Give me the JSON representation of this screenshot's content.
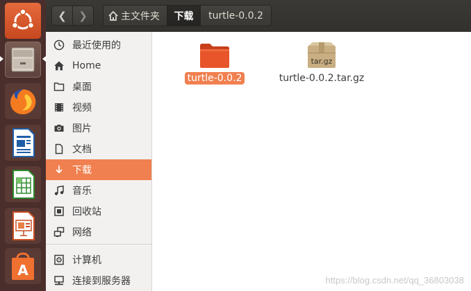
{
  "launcher": {
    "items": [
      {
        "name": "ubuntu-dash",
        "color": "#e35c2f"
      },
      {
        "name": "files",
        "color": "#c9b8a8"
      },
      {
        "name": "firefox",
        "color": "#f47b20"
      },
      {
        "name": "libreoffice-writer",
        "color": "#2a6eb5"
      },
      {
        "name": "libreoffice-calc",
        "color": "#3c9d3c"
      },
      {
        "name": "libreoffice-impress",
        "color": "#d4592f"
      },
      {
        "name": "software-center",
        "color": "#f07030"
      }
    ]
  },
  "header": {
    "back_glyph": "❮",
    "forward_glyph": "❯",
    "breadcrumbs": [
      {
        "label": "主文件夹",
        "icon": "home-icon"
      },
      {
        "label": "下载",
        "active": true
      },
      {
        "label": "turtle-0.0.2"
      }
    ]
  },
  "sidebar": {
    "items": [
      {
        "label": "最近使用的",
        "icon": "clock-icon"
      },
      {
        "label": "Home",
        "icon": "home-icon"
      },
      {
        "label": "桌面",
        "icon": "folder-icon"
      },
      {
        "label": "视频",
        "icon": "video-icon"
      },
      {
        "label": "图片",
        "icon": "camera-icon"
      },
      {
        "label": "文档",
        "icon": "document-icon"
      },
      {
        "label": "下载",
        "icon": "download-icon",
        "selected": true
      },
      {
        "label": "音乐",
        "icon": "music-icon"
      },
      {
        "label": "回收站",
        "icon": "trash-icon"
      },
      {
        "label": "网络",
        "icon": "network-icon"
      },
      {
        "label": "计算机",
        "icon": "computer-icon"
      },
      {
        "label": "连接到服务器",
        "icon": "server-icon"
      }
    ]
  },
  "files": [
    {
      "label": "turtle-0.0.2",
      "type": "folder",
      "selected": true
    },
    {
      "label": "turtle-0.0.2.tar.gz",
      "type": "archive",
      "icon_text": "tar.gz"
    }
  ],
  "watermark": "https://blog.csdn.net/qq_36803038",
  "colors": {
    "accent": "#f08050",
    "header": "#3b3935",
    "launcher": "#4a2e2b"
  }
}
